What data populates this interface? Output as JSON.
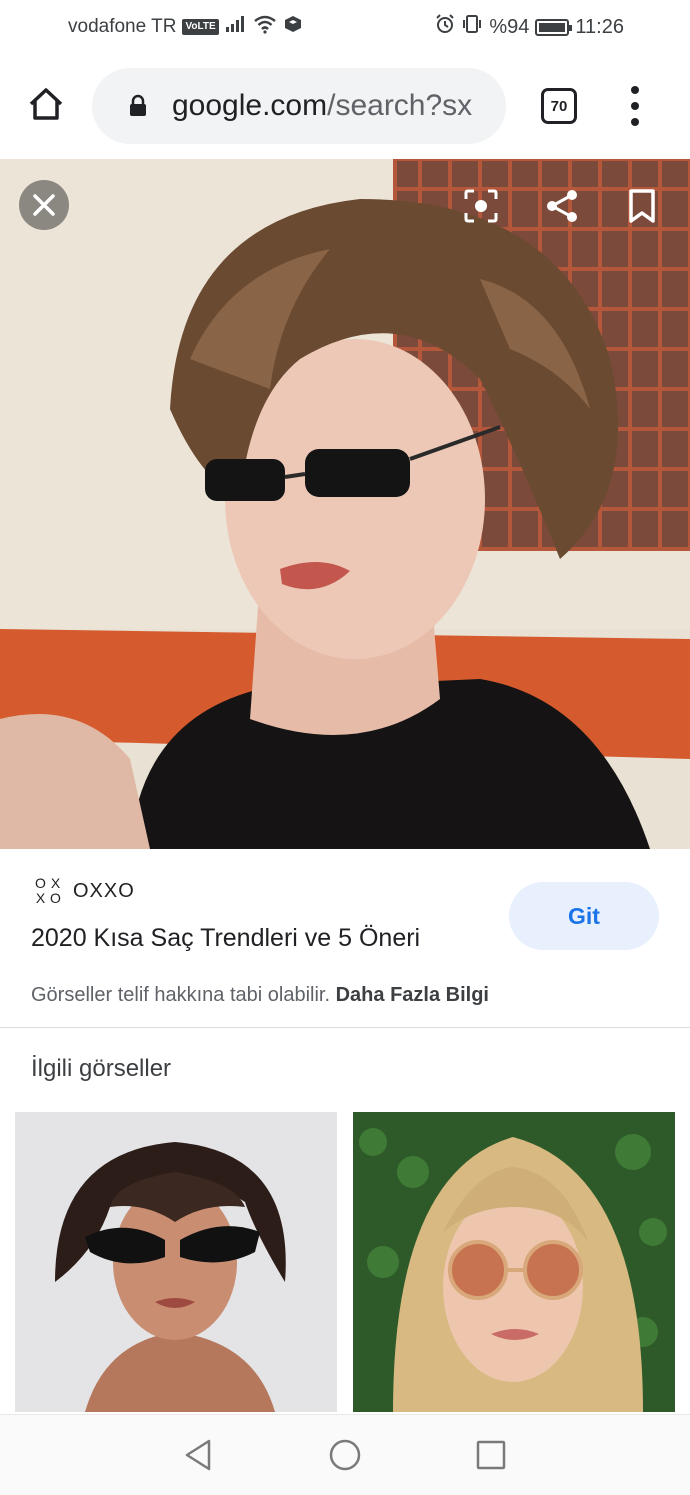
{
  "status_bar": {
    "carrier": "vodafone TR",
    "volte": "VoLTE",
    "battery_text": "%94",
    "battery_level": 0.94,
    "time": "11:26",
    "icons": [
      "signal-icon",
      "wifi-icon",
      "data-icon",
      "alarm-icon",
      "vibrate-icon",
      "battery-icon"
    ]
  },
  "toolbar": {
    "url_domain": "google.com",
    "url_path": "/search?sx",
    "tab_count": "70"
  },
  "main_image": {
    "description_icons": [
      "close-icon",
      "lens-icon",
      "share-icon",
      "bookmark-icon"
    ]
  },
  "result": {
    "source_logo": [
      "O",
      "X",
      "X",
      "O"
    ],
    "source_name": "OXXO",
    "title": "2020 Kısa Saç Trendleri ve 5 Öneri",
    "visit_button": "Git",
    "copyright_text": "Görseller telif hakkına tabi olabilir.",
    "more_info_link": "Daha Fazla Bilgi"
  },
  "related": {
    "title": "İlgili görseller"
  },
  "colors": {
    "accent": "#1a73e8",
    "button_bg": "#e8f0fe",
    "url_bar_bg": "#f1f3f4"
  }
}
